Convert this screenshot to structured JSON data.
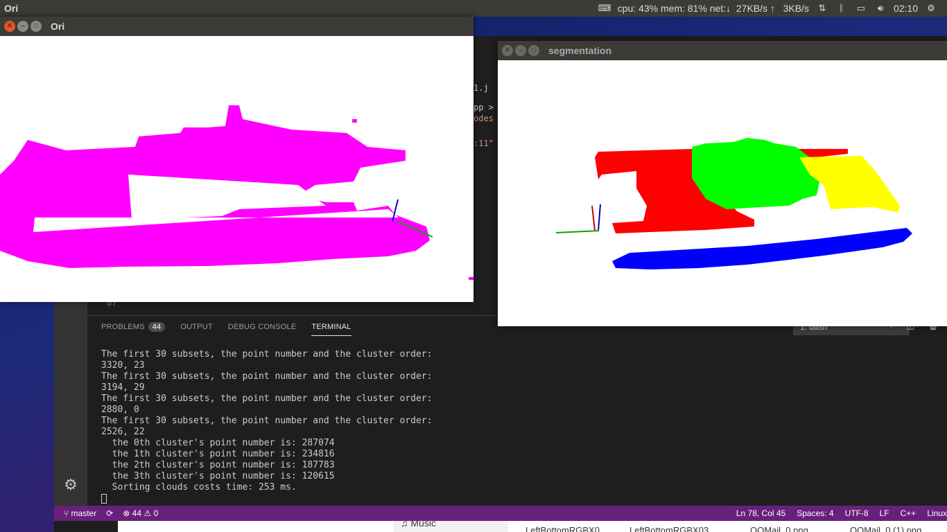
{
  "topbar": {
    "app_name": "Ori",
    "indicator": "cpu: 43% mem: 81% net:↓  27KB/s ↑   3KB/s",
    "clock": "02:10"
  },
  "vscode": {
    "editor_snippets": [
      "1.j",
      "pp > D",
      "odes",
      ":11\""
    ],
    "line_number": "87",
    "panel_tabs": {
      "problems": "PROBLEMS",
      "problems_count": "44",
      "output": "OUTPUT",
      "debug": "DEBUG CONSOLE",
      "terminal": "TERMINAL"
    },
    "terminal_select": "1: bash",
    "terminal_lines": [
      "The first 30 subsets, the point number and the cluster order:",
      "3320, 23",
      "The first 30 subsets, the point number and the cluster order:",
      "3194, 29",
      "The first 30 subsets, the point number and the cluster order:",
      "2880, 0",
      "The first 30 subsets, the point number and the cluster order:",
      "2526, 22",
      "  the 0th cluster's point number is: 287074",
      "  the 1th cluster's point number is: 234816",
      "  the 2th cluster's point number is: 187783",
      "  the 3th cluster's point number is: 120615",
      "  Sorting clouds costs time: 253 ms."
    ],
    "statusbar": {
      "branch": "master",
      "problems": "⊗ 44 ⚠ 0",
      "position": "Ln 78, Col 45",
      "spaces": "Spaces: 4",
      "encoding": "UTF-8",
      "eol": "LF",
      "language": "C++",
      "platform": "Linux"
    }
  },
  "files_strip": {
    "music": "Music",
    "files": [
      "LeftBottomRGBX0",
      "LeftBottomRGBX03",
      "QQMail_0.png",
      "QQMail_0 (1).png"
    ]
  },
  "window_ori": {
    "title": "Ori",
    "cloud_color": "#ff00ff"
  },
  "window_seg": {
    "title": "segmentation",
    "cluster_colors": [
      "#ff0000",
      "#00ff00",
      "#ffff00",
      "#0000ff"
    ]
  }
}
